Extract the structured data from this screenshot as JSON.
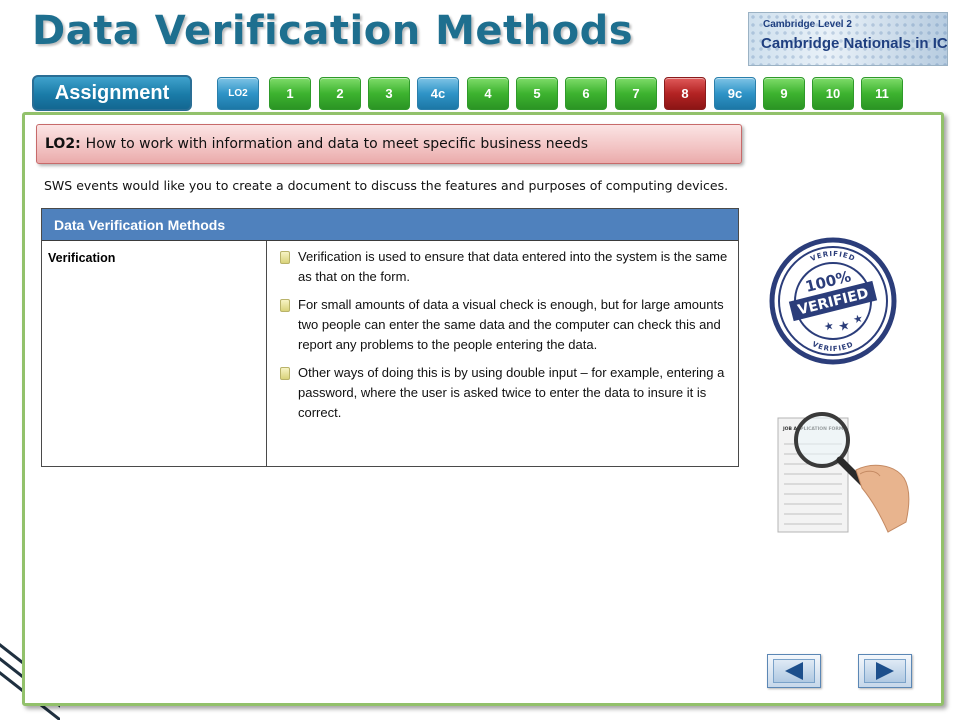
{
  "header": {
    "title": "Data Verification Methods",
    "logo": {
      "line1": "Cambridge Level 2",
      "line2": "Cambridge Nationals in ICT"
    }
  },
  "nav": {
    "assignment_label": "Assignment",
    "tabs": [
      {
        "label": "LO2",
        "color": "blue"
      },
      {
        "label": "1",
        "color": "green"
      },
      {
        "label": "2",
        "color": "green"
      },
      {
        "label": "3",
        "color": "green"
      },
      {
        "label": "4c",
        "color": "blue"
      },
      {
        "label": "4",
        "color": "green"
      },
      {
        "label": "5",
        "color": "green"
      },
      {
        "label": "6",
        "color": "green"
      },
      {
        "label": "7",
        "color": "green"
      },
      {
        "label": "8",
        "color": "red"
      },
      {
        "label": "9c",
        "color": "blue"
      },
      {
        "label": "9",
        "color": "green"
      },
      {
        "label": "10",
        "color": "green"
      },
      {
        "label": "11",
        "color": "green"
      }
    ]
  },
  "banner": {
    "prefix": "LO2:",
    "text": "How to work with information and data to meet specific business needs"
  },
  "intro": "SWS events would like you to create a document to discuss the features and purposes of computing devices.",
  "table": {
    "header": "Data Verification Methods",
    "row_label": "Verification",
    "bullets": [
      "Verification is used to ensure that data entered into the system is the same as that on the form.",
      "For small amounts of data a visual check is enough, but for large amounts two people can enter the same data and the computer can check this and report any problems to the people entering the data.",
      "Other ways of doing this is by using double input – for example, entering a password, where the user is asked twice to enter the data to insure it is correct."
    ]
  },
  "stamp": {
    "percent": "100%",
    "word": "VERIFIED",
    "ring_text": "VERIFIED"
  },
  "form_image": {
    "title": "JOB APPLICATION FORM"
  },
  "colors": {
    "title": "#1e6f8f",
    "frame": "#92c16b",
    "table_header": "#4f81bd",
    "stamp": "#2b3d7a",
    "active_tab": "#b32323"
  },
  "icons": {
    "prev": "triangle-left-icon",
    "next": "triangle-right-icon",
    "bullet": "note-bullet-icon"
  }
}
